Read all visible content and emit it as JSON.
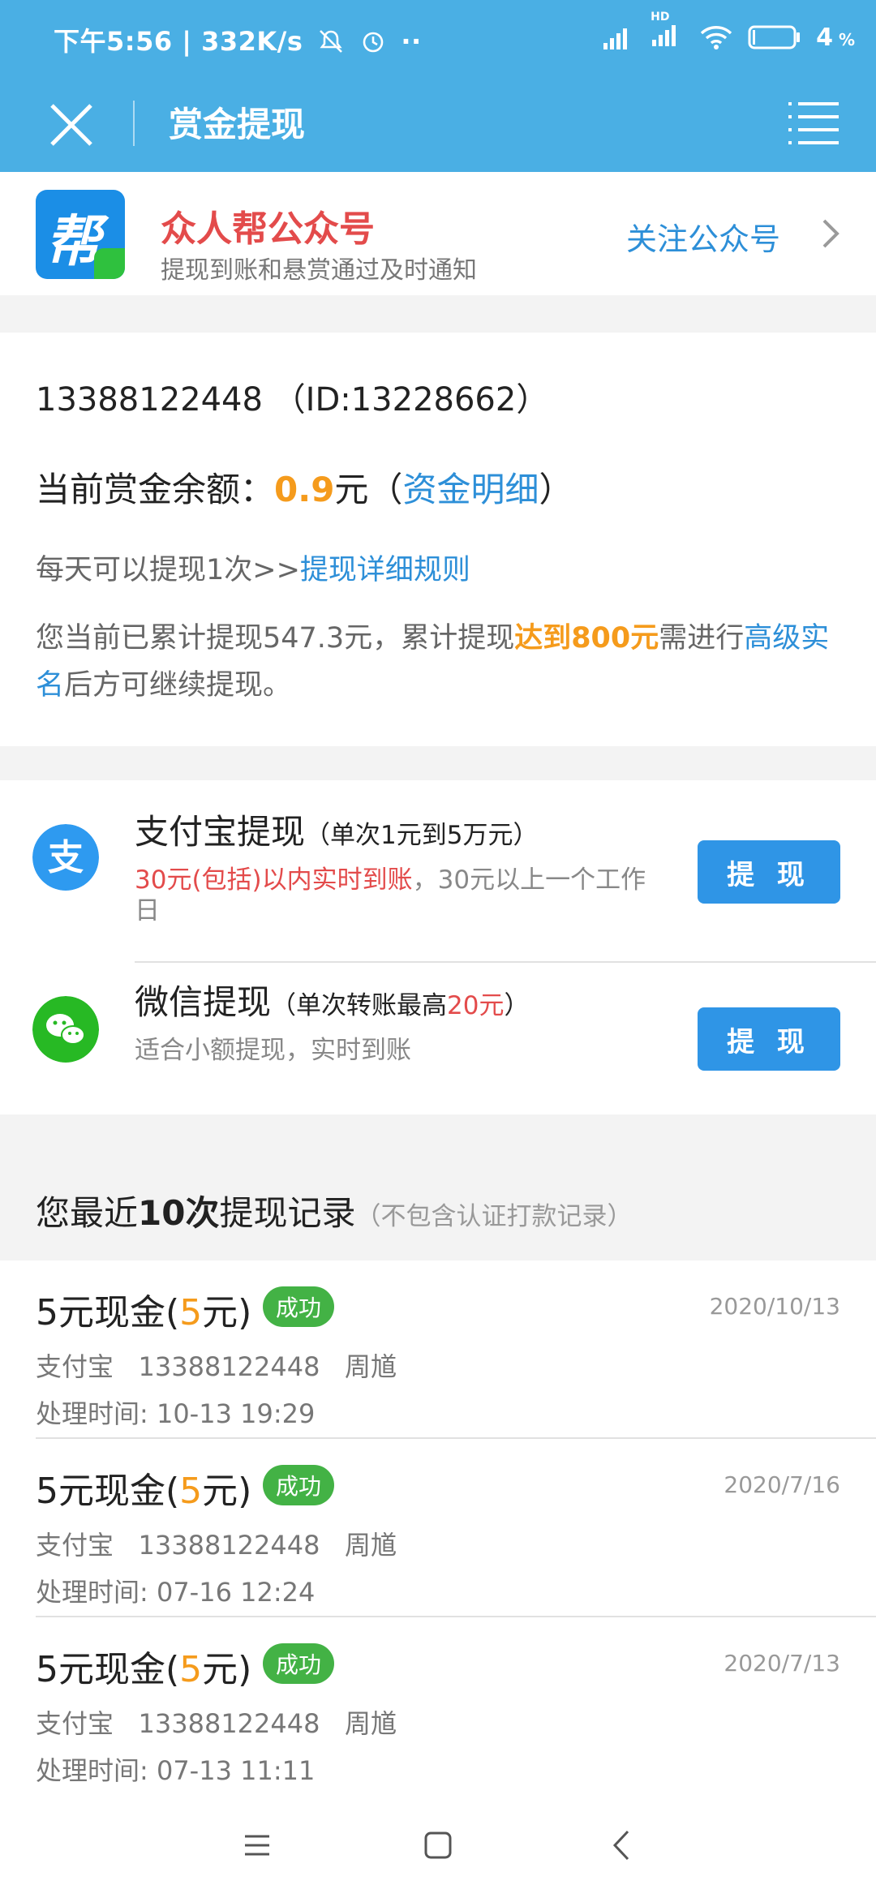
{
  "status_bar": {
    "time_speed": "下午5:56 | 332K/s",
    "network_hd": "HD",
    "battery": "4"
  },
  "nav": {
    "title": "赏金提现"
  },
  "follow": {
    "name": "众人帮公众号",
    "desc": "提现到账和悬赏通过及时通知",
    "button": "关注公众号",
    "logo_glyph": "帮"
  },
  "account": {
    "line": "13388122448 （ID:13228662）",
    "balance_label": "当前赏金余额：",
    "balance_value": "0.9",
    "balance_unit": "元（",
    "balance_link": "资金明细",
    "balance_end": "）",
    "rule_prefix": "每天可以提现1次>>",
    "rule_link": "提现详细规则",
    "note_prefix": "您当前已累计提现547.3元，累计提现",
    "note_highlight": "达到800元",
    "note_mid": "需进行",
    "note_link": "高级实名",
    "note_suffix": "后方可继续提现。"
  },
  "withdraw": {
    "alipay": {
      "title": "支付宝提现",
      "limit": "（单次1元到5万元）",
      "sub_red": "30元(包括)以内实时到账",
      "sub_rest": "，30元以上一个工作日",
      "button": "提 现",
      "icon_glyph": "支"
    },
    "wechat": {
      "title": "微信提现",
      "limit_prefix": "（单次转账最高",
      "limit_value": "20元",
      "limit_suffix": "）",
      "sub": "适合小额提现，实时到账",
      "button": "提 现"
    }
  },
  "history": {
    "title_prefix": "您最近",
    "title_bold": "10次",
    "title_suffix": "提现记录",
    "subtitle": "（不包含认证打款记录）",
    "records": [
      {
        "title_a": "5元现金(",
        "title_num": "5",
        "title_b": "元)",
        "status": "成功",
        "date": "2020/10/13",
        "meta": "支付宝   13388122448   周馗",
        "time": "处理时间: 10-13 19:29"
      },
      {
        "title_a": "5元现金(",
        "title_num": "5",
        "title_b": "元)",
        "status": "成功",
        "date": "2020/7/16",
        "meta": "支付宝   13388122448   周馗",
        "time": "处理时间: 07-16 12:24"
      },
      {
        "title_a": "5元现金(",
        "title_num": "5",
        "title_b": "元)",
        "status": "成功",
        "date": "2020/7/13",
        "meta": "支付宝   13388122448   周馗",
        "time": "处理时间: 07-13 11:11"
      }
    ]
  },
  "colors": {
    "header": "#4aafe4",
    "accent_blue": "#2d8fd8",
    "orange": "#f59b1c",
    "red": "#e34b4b",
    "green_badge": "#43b245"
  },
  "icons": [
    "signal-icon",
    "wifi-icon",
    "battery-icon",
    "mute-bell-icon",
    "alarm-icon",
    "close-icon",
    "menu-icon",
    "chevron-right-icon",
    "alipay-icon",
    "wechat-icon",
    "nav-menu-icon",
    "nav-home-icon",
    "nav-back-icon"
  ]
}
